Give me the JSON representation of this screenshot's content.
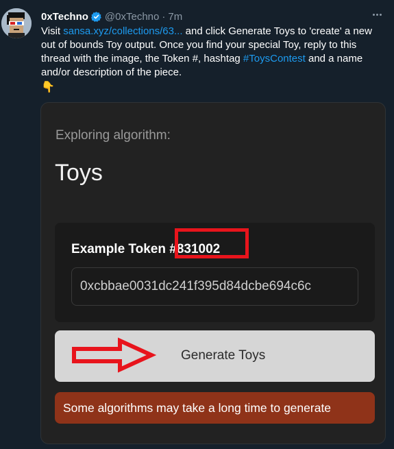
{
  "tweet": {
    "display_name": "0xTechno",
    "handle": "@0xTechno",
    "separator": "·",
    "time": "7m",
    "text_intro": "Visit ",
    "link": "sansa.xyz/collections/63...",
    "text_mid": " and click Generate Toys to 'create' a new out of bounds Toy output. Once you find your special Toy, reply to this thread with the image, the Token #, hashtag ",
    "hashtag": "#ToysContest",
    "text_end": " and a name and/or description of the piece.",
    "emoji": "👇",
    "more_icon": "more-horizontal-icon"
  },
  "card": {
    "exploring_label": "Exploring algorithm:",
    "algorithm_name": "Toys",
    "token_label": "Example Token #831002",
    "hash_value": "0xcbbae0031dc241f395d84dcbe694c6c",
    "generate_label": "Generate Toys",
    "warning": "Some algorithms may take a long time to generate",
    "accent_red": "#e8141c",
    "warning_color": "#8f3319"
  }
}
